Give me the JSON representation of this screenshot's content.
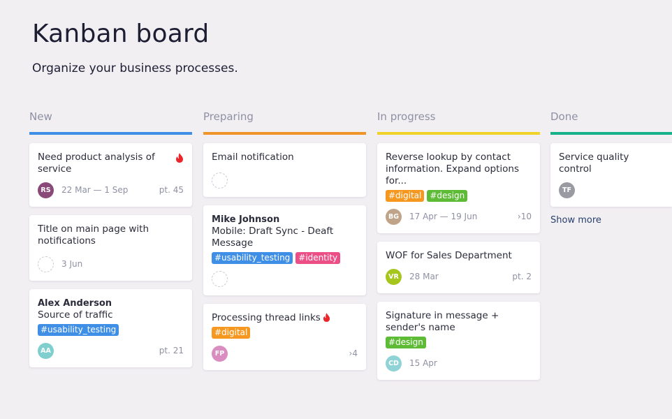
{
  "page": {
    "title": "Kanban board",
    "subtitle": "Organize your business processes."
  },
  "colors": {
    "new": "#3f8fe6",
    "preparing": "#f0952a",
    "in_progress": "#f1d22b",
    "done": "#17b28a",
    "tag_blue": "#3f8fe6",
    "tag_pink": "#eb4f86",
    "tag_orange": "#f6971f",
    "tag_green": "#5dbb36"
  },
  "columns": [
    {
      "title": "New",
      "cards": [
        {
          "title": "Need product analysis of service",
          "hot": true,
          "avatar": "RS",
          "avatar_color": "#8a4a78",
          "date": "22 Mar — 1 Sep",
          "meta": "pt. 45"
        },
        {
          "title": "Title on main page with notifications",
          "date": "3 Jun"
        },
        {
          "author": "Alex Anderson",
          "title": "Source of traffic",
          "tags": [
            "#usability_testing"
          ],
          "avatar": "AA",
          "avatar_color": "#7fcfce",
          "meta": "pt. 21"
        }
      ]
    },
    {
      "title": "Preparing",
      "cards": [
        {
          "title": "Email notification"
        },
        {
          "author": "Mike Johnson",
          "title": "Mobile: Draft Sync - Deaft Message",
          "tags": [
            "#usability_testing",
            "#identity"
          ]
        },
        {
          "title": "Processing thread links",
          "tags": [
            "#digital"
          ],
          "avatar": "FP",
          "avatar_color": "#d98dc0",
          "meta": "4"
        }
      ]
    },
    {
      "title": "In progress",
      "cards": [
        {
          "title": "Reverse lookup by contact information. Expand options for...",
          "tags": [
            "#digital",
            "#design"
          ],
          "avatar": "BG",
          "avatar_color": "#bfa48a",
          "date": "17 Apr — 19 Jun",
          "meta": "10"
        },
        {
          "title": "WOF for Sales Department",
          "avatar": "VR",
          "avatar_color": "#a6c51d",
          "date": "28 Mar",
          "meta": "pt. 2"
        },
        {
          "title": "Signature in message + sender's name",
          "tags": [
            "#design"
          ],
          "avatar": "CD",
          "avatar_color": "#8fd3d6",
          "date": "15 Apr"
        }
      ]
    },
    {
      "title": "Done",
      "cards": [
        {
          "title": "Service quality control",
          "avatar": "TF",
          "avatar_color": "#9a9aa3"
        }
      ],
      "show_more": "Show more"
    }
  ]
}
